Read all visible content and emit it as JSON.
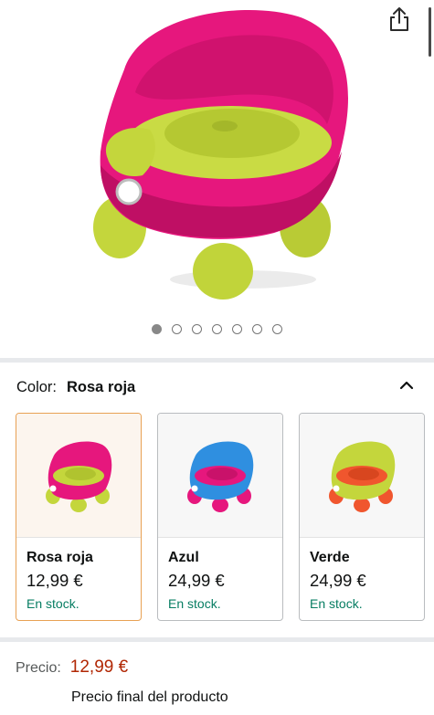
{
  "product": {
    "image": {
      "icon": "potty-chair-image",
      "body_color": "#e6177d",
      "seat_color": "#c4d63c"
    }
  },
  "gallery": {
    "total": 7,
    "active": 1
  },
  "variation": {
    "label": "Color:",
    "selected": "Rosa roja",
    "options": [
      {
        "name": "Rosa roja",
        "price": "12,99 €",
        "stock": "En stock.",
        "body_color": "#e6177d",
        "seat_color": "#c4d63c",
        "selected": true
      },
      {
        "name": "Azul",
        "price": "24,99 €",
        "stock": "En stock.",
        "body_color": "#2f8fe0",
        "seat_color": "#e6177d",
        "selected": false
      },
      {
        "name": "Verde",
        "price": "24,99 €",
        "stock": "En stock.",
        "body_color": "#c4d63c",
        "seat_color": "#f0562e",
        "selected": false
      }
    ]
  },
  "price": {
    "label": "Precio:",
    "value": "12,99 €",
    "note": "Precio final del producto"
  },
  "colors": {
    "price_red": "#b12704",
    "stock_green": "#067d62",
    "selected_border": "#e8a154"
  }
}
